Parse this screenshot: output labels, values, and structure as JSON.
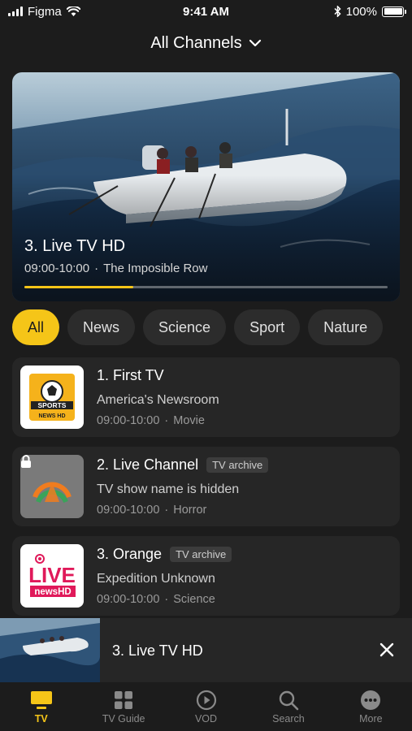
{
  "status_bar": {
    "carrier": "Figma",
    "time": "9:41 AM",
    "battery": "100%"
  },
  "header": {
    "title": "All Channels"
  },
  "hero": {
    "title": "3. Live TV HD",
    "time": "09:00-10:00",
    "separator": "·",
    "program": "The Imposible Row",
    "progress": 0.3,
    "accent": "#f5c518"
  },
  "categories": {
    "items": [
      "All",
      "News",
      "Science",
      "Sport",
      "Nature"
    ],
    "active": "All"
  },
  "channels": [
    {
      "name": "1. First TV",
      "show": "America's Newsroom",
      "time": "09:00-10:00",
      "separator": "·",
      "genre": "Movie",
      "badge": "",
      "logo": "SPORTS NEWS HD",
      "locked": false
    },
    {
      "name": "2. Live Channel",
      "show": "TV show name is hidden",
      "time": "09:00-10:00",
      "separator": "·",
      "genre": "Horror",
      "badge": "TV archive",
      "logo": "",
      "locked": true
    },
    {
      "name": "3. Orange",
      "show": "Expedition Unknown",
      "time": "09:00-10:00",
      "separator": "·",
      "genre": "Science",
      "badge": "TV archive",
      "logo": "LIVE newsHD",
      "locked": false
    }
  ],
  "mini_player": {
    "title": "3. Live TV HD"
  },
  "tab_bar": {
    "active": "TV",
    "tabs": [
      {
        "label": "TV",
        "icon": "tv-icon"
      },
      {
        "label": "TV Guide",
        "icon": "grid-icon"
      },
      {
        "label": "VOD",
        "icon": "play-circle-icon"
      },
      {
        "label": "Search",
        "icon": "search-icon"
      },
      {
        "label": "More",
        "icon": "more-icon"
      }
    ]
  }
}
